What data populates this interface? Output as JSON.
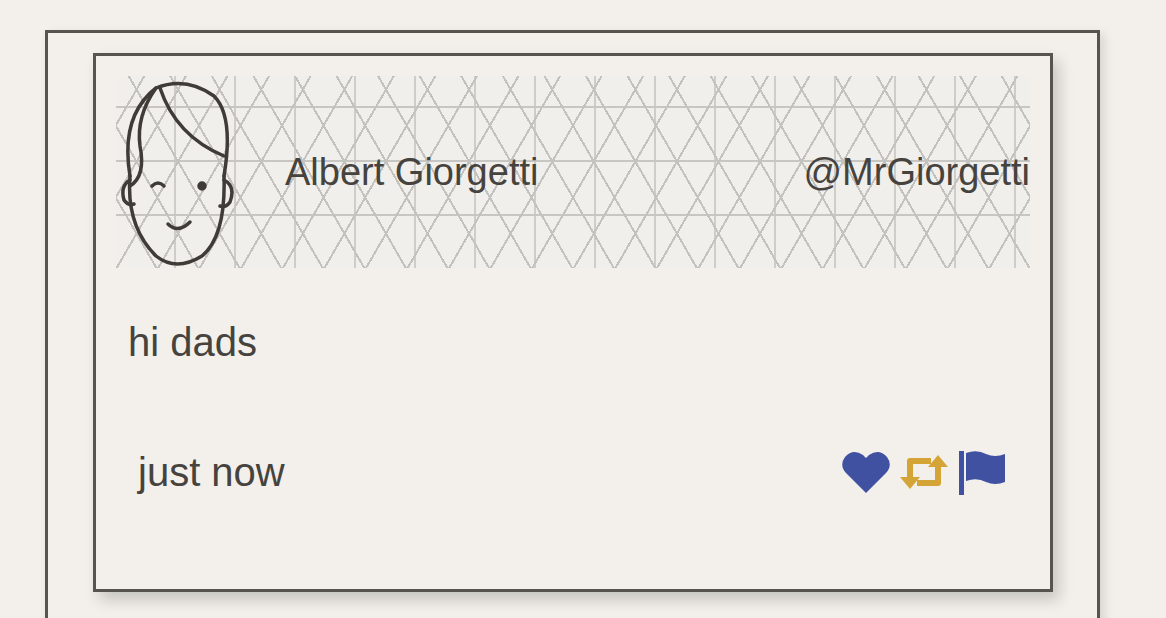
{
  "tweet": {
    "name": "Albert Giorgetti",
    "handle": "@MrGiorgetti",
    "text": "hi dads",
    "time": "just now"
  },
  "actions": [
    {
      "kind": "like",
      "color": "#3f51a0"
    },
    {
      "kind": "retweet",
      "color": "#d4a437"
    },
    {
      "kind": "flag",
      "color": "#3f51a0"
    }
  ]
}
